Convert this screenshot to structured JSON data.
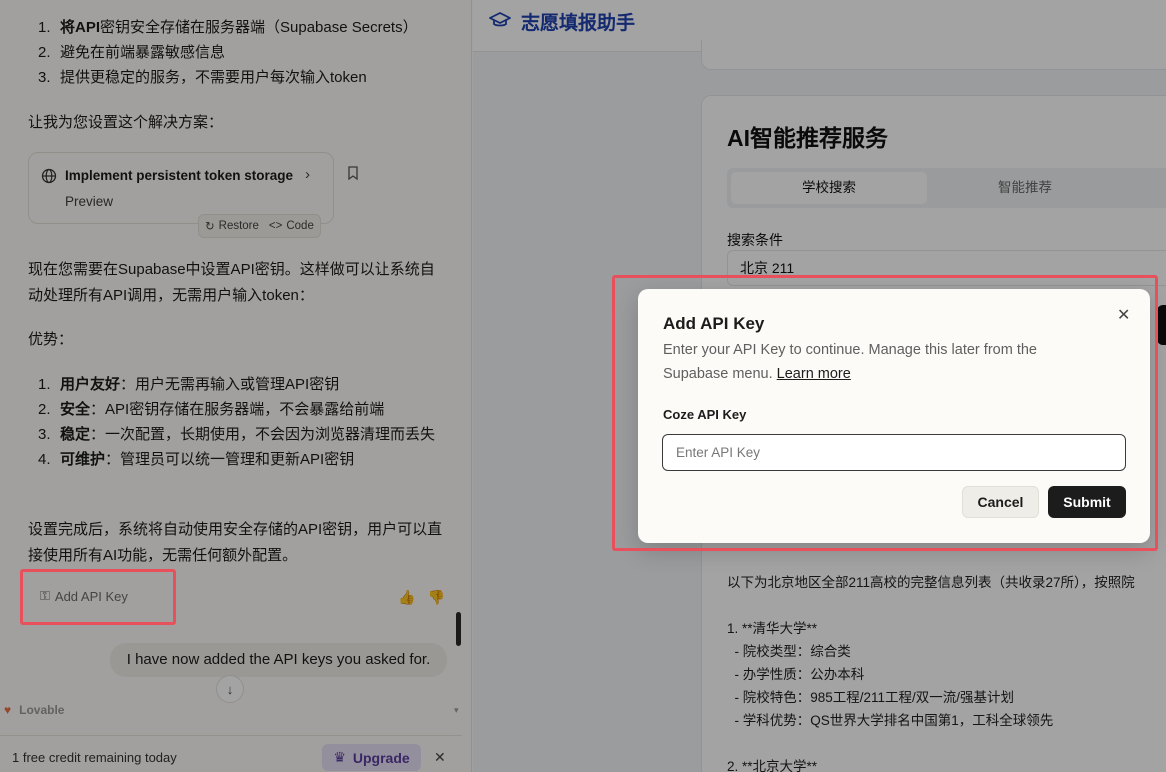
{
  "chat": {
    "list1": [
      {
        "num": "1.",
        "bold": "将API",
        "rest": "密钥安全存储在服务器端（Supabase Secrets）"
      },
      {
        "num": "2.",
        "bold": "",
        "rest": "避免在前端暴露敏感信息"
      },
      {
        "num": "3.",
        "bold": "",
        "rest": "提供更稳定的服务，不需要用户每次输入token"
      }
    ],
    "para1": "让我为您设置这个解决方案：",
    "card": {
      "title": "Implement persistent token storage",
      "preview": "Preview",
      "restore": "Restore",
      "code": "Code"
    },
    "para2": "现在您需要在Supabase中设置API密钥。这样做可以让系统自动处理所有API调用，无需用户输入token：",
    "para3": "优势：",
    "list2": [
      {
        "num": "1.",
        "bold": "用户友好",
        "rest": "：用户无需再输入或管理API密钥"
      },
      {
        "num": "2.",
        "bold": "安全",
        "rest": "：API密钥存储在服务器端，不会暴露给前端"
      },
      {
        "num": "3.",
        "bold": "稳定",
        "rest": "：一次配置，长期使用，不会因为浏览器清理而丢失"
      },
      {
        "num": "4.",
        "bold": "可维护",
        "rest": "：管理员可以统一管理和更新API密钥"
      }
    ],
    "para4": "设置完成后，系统将自动使用安全存储的API密钥，用户可以直接使用所有AI功能，无需任何额外配置。",
    "add_api_key": "Add API Key",
    "user_message": "I have now added the API keys you asked for.",
    "lovable": "Lovable",
    "credit_text": "1 free credit remaining today",
    "upgrade_label": "Upgrade"
  },
  "preview": {
    "app_title": "志愿填报助手",
    "section_title": "AI智能推荐服务",
    "tabs": [
      "学校搜索",
      "智能推荐"
    ],
    "field_label": "搜索条件",
    "field_value": "北京 211",
    "results": [
      "以下为北京地区全部211高校的完整信息列表（共收录27所），按照院",
      "",
      "1. **清华大学**",
      "  - 院校类型：综合类",
      "  - 办学性质：公办本科",
      "  - 院校特色：985工程/211工程/双一流/强基计划",
      "  - 学科优势：QS世界大学排名中国第1，工科全球领先",
      "",
      "2. **北京大学**"
    ]
  },
  "dialog": {
    "title": "Add API Key",
    "description": "Enter your API Key to continue. Manage this later from the Supabase menu.",
    "learn_more": "Learn more",
    "field_label": "Coze API Key",
    "input_placeholder": "Enter API Key",
    "input_value": "",
    "cancel_label": "Cancel",
    "submit_label": "Submit"
  },
  "colors": {
    "highlight": "#e8505b",
    "app_title": "#1e40af",
    "upgrade_bg": "#e8e0f6",
    "upgrade_text": "#5a3e9e"
  }
}
